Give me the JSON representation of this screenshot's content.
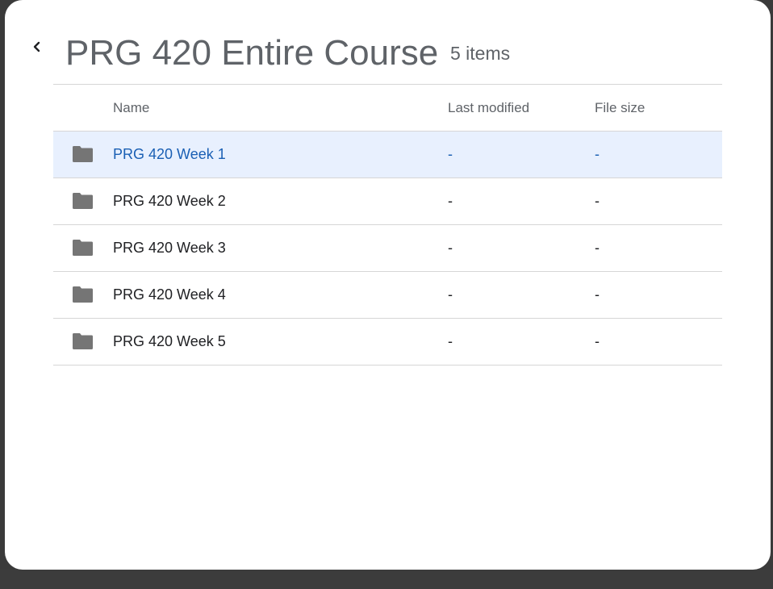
{
  "dialog": {
    "title": "PRG 420 Entire Course",
    "item_count": "5 items"
  },
  "icons": {
    "back": "chevron-left-icon",
    "folder": "folder-icon"
  },
  "colors": {
    "selected_row_bg": "#e8f0fe",
    "selected_text": "#1a5fb4",
    "folder": "#757575"
  },
  "table": {
    "columns": [
      "Name",
      "Last modified",
      "File size"
    ],
    "rows": [
      {
        "name": "PRG 420 Week 1",
        "modified": "-",
        "size": "-",
        "selected": true
      },
      {
        "name": "PRG 420 Week 2",
        "modified": "-",
        "size": "-",
        "selected": false
      },
      {
        "name": "PRG 420 Week 3",
        "modified": "-",
        "size": "-",
        "selected": false
      },
      {
        "name": "PRG 420 Week 4",
        "modified": "-",
        "size": "-",
        "selected": false
      },
      {
        "name": "PRG 420 Week 5",
        "modified": "-",
        "size": "-",
        "selected": false
      }
    ]
  }
}
